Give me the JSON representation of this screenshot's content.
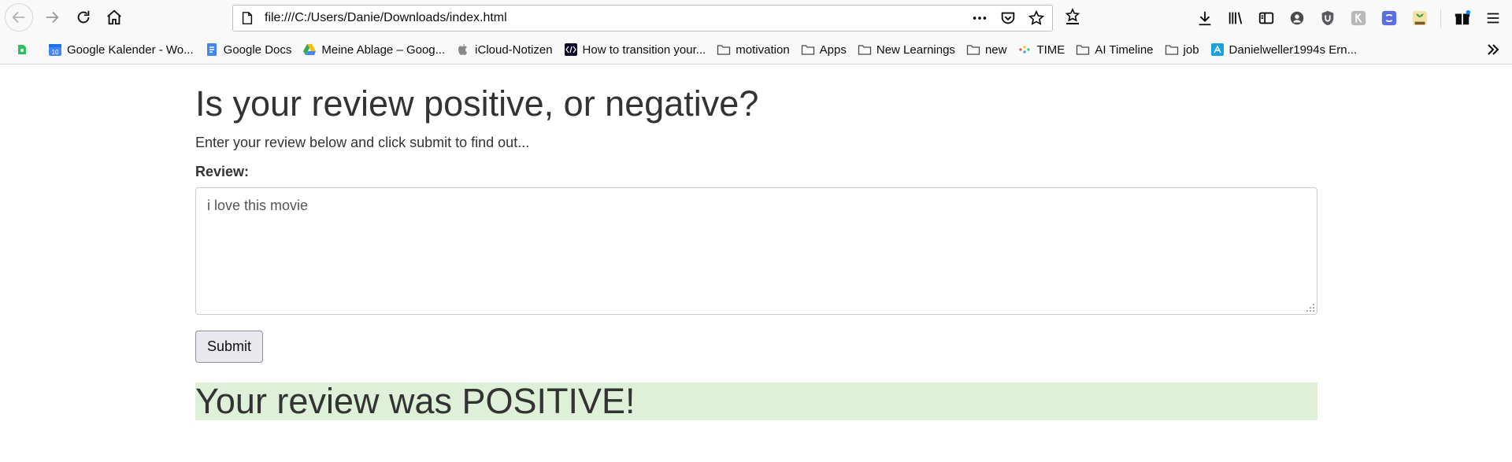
{
  "browser": {
    "url": "file:///C:/Users/Danie/Downloads/index.html",
    "colors": {
      "toolbar_bg": "#f9f9fa",
      "accent_blue": "#0a84ff"
    }
  },
  "bookmarks": [
    {
      "icon": "evernote-icon",
      "label": ""
    },
    {
      "icon": "google-calendar-icon",
      "label": "Google Kalender - Wo..."
    },
    {
      "icon": "google-docs-icon",
      "label": "Google Docs"
    },
    {
      "icon": "google-drive-icon",
      "label": "Meine Ablage – Goog..."
    },
    {
      "icon": "apple-icon",
      "label": "iCloud-Notizen"
    },
    {
      "icon": "site-icon",
      "label": "How to transition your..."
    },
    {
      "icon": "folder-icon",
      "label": "motivation"
    },
    {
      "icon": "folder-icon",
      "label": "Apps"
    },
    {
      "icon": "folder-icon",
      "label": "New Learnings"
    },
    {
      "icon": "folder-icon",
      "label": "new"
    },
    {
      "icon": "time-icon",
      "label": "TIME"
    },
    {
      "icon": "folder-icon",
      "label": "AI Timeline"
    },
    {
      "icon": "folder-icon",
      "label": "job"
    },
    {
      "icon": "profile-icon",
      "label": "Danielweller1994s Ern..."
    }
  ],
  "page": {
    "title": "Is your review positive, or negative?",
    "intro": "Enter your review below and click submit to find out...",
    "review_label": "Review:",
    "review_value": "i love this movie",
    "submit_label": "Submit",
    "result_text": "Your review was POSITIVE!",
    "result_bg": "#dff0d8"
  }
}
